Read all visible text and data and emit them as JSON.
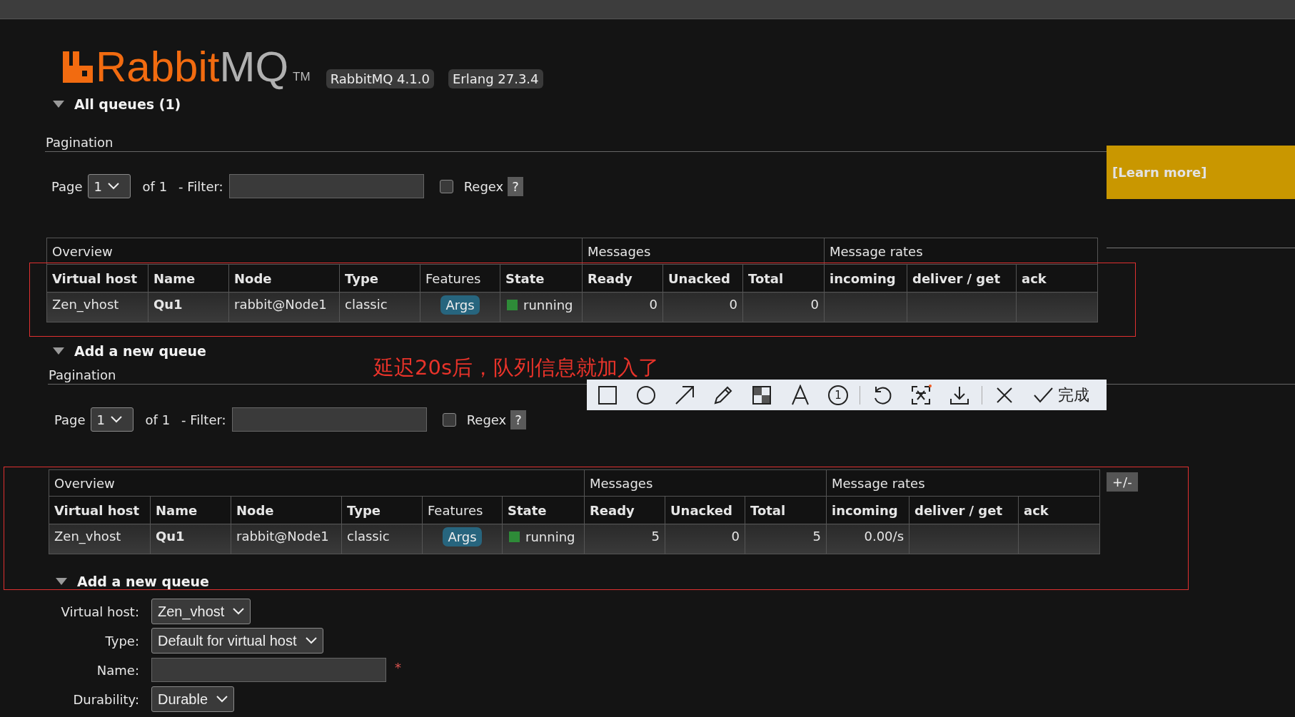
{
  "header": {
    "logo": [
      "Rabbit",
      "MQ"
    ],
    "trademark": "TM",
    "badges": [
      "RabbitMQ 4.1.0",
      "Erlang 27.3.4"
    ]
  },
  "learn_more": "[Learn more]",
  "blocks": [
    {
      "kind": "heading",
      "text": "All queues (1)",
      "expanded": true
    },
    {
      "kind": "pagination",
      "label": "Pagination",
      "page_label": "Page",
      "page": "1",
      "of": "of 1",
      "filter_label": "- Filter:",
      "regex": {
        "label": "Regex",
        "checked": false
      },
      "help": "?"
    },
    {
      "kind": "table",
      "groups": [
        {
          "label": "Overview",
          "columns": [
            {
              "label": "Virtual host"
            },
            {
              "label": "Name"
            },
            {
              "label": "Node"
            },
            {
              "label": "Type"
            },
            {
              "label": "Features",
              "kind": "plain"
            },
            {
              "label": "State"
            }
          ]
        },
        {
          "label": "Messages",
          "columns": [
            {
              "label": "Ready"
            },
            {
              "label": "Unacked"
            },
            {
              "label": "Total"
            }
          ]
        },
        {
          "label": "Message rates",
          "columns": [
            {
              "label": "incoming"
            },
            {
              "label": "deliver / get"
            },
            {
              "label": "ack"
            }
          ]
        }
      ],
      "rows": [
        {
          "cells": [
            {
              "kind": "text",
              "text": "Zen_vhost"
            },
            {
              "kind": "strong",
              "text": "Qu1"
            },
            {
              "kind": "text",
              "text": "rabbit@Node1"
            },
            {
              "kind": "text",
              "text": "classic"
            },
            {
              "kind": "badge",
              "text": "Args"
            },
            {
              "kind": "status",
              "text": "running",
              "color": "#2e8b38"
            },
            {
              "kind": "number",
              "text": "0"
            },
            {
              "kind": "number",
              "text": "0"
            },
            {
              "kind": "number",
              "text": "0"
            },
            {
              "kind": "empty"
            },
            {
              "kind": "empty"
            },
            {
              "kind": "empty"
            }
          ]
        }
      ]
    },
    {
      "kind": "heading",
      "text": "Add a new queue",
      "expanded": true
    },
    {
      "kind": "annotation",
      "text": "延迟20s后，队列信息就加入了"
    },
    {
      "kind": "pagination",
      "label": "Pagination",
      "page_label": "Page",
      "page": "1",
      "of": "of 1",
      "filter_label": "- Filter:",
      "regex": {
        "label": "Regex",
        "checked": false
      },
      "help": "?"
    },
    {
      "kind": "table",
      "toggle": "+/-",
      "groups": [
        {
          "label": "Overview",
          "columns": [
            {
              "label": "Virtual host"
            },
            {
              "label": "Name"
            },
            {
              "label": "Node"
            },
            {
              "label": "Type"
            },
            {
              "label": "Features",
              "kind": "plain"
            },
            {
              "label": "State"
            }
          ]
        },
        {
          "label": "Messages",
          "columns": [
            {
              "label": "Ready"
            },
            {
              "label": "Unacked"
            },
            {
              "label": "Total"
            }
          ]
        },
        {
          "label": "Message rates",
          "columns": [
            {
              "label": "incoming"
            },
            {
              "label": "deliver / get"
            },
            {
              "label": "ack"
            }
          ]
        }
      ],
      "rows": [
        {
          "cells": [
            {
              "kind": "text",
              "text": "Zen_vhost"
            },
            {
              "kind": "strong",
              "text": "Qu1"
            },
            {
              "kind": "text",
              "text": "rabbit@Node1"
            },
            {
              "kind": "text",
              "text": "classic"
            },
            {
              "kind": "badge",
              "text": "Args"
            },
            {
              "kind": "status",
              "text": "running",
              "color": "#2e8b38"
            },
            {
              "kind": "number",
              "text": "5"
            },
            {
              "kind": "number",
              "text": "0"
            },
            {
              "kind": "number",
              "text": "5"
            },
            {
              "kind": "number",
              "text": "0.00/s"
            },
            {
              "kind": "empty"
            },
            {
              "kind": "empty"
            }
          ]
        }
      ]
    },
    {
      "kind": "heading",
      "text": "Add a new queue",
      "expanded": true
    },
    {
      "kind": "form",
      "fields": [
        {
          "kind": "select",
          "label": "Virtual host:",
          "value": "Zen_vhost"
        },
        {
          "kind": "select",
          "label": "Type:",
          "value": "Default for virtual host"
        },
        {
          "kind": "input",
          "label": "Name:",
          "required_mark": "*"
        },
        {
          "kind": "select",
          "label": "Durability:",
          "value": "Durable"
        }
      ]
    }
  ],
  "capture_toolbar": {
    "tools": [
      {
        "kind": "rectangle"
      },
      {
        "kind": "ellipse"
      },
      {
        "kind": "arrow"
      },
      {
        "kind": "pencil"
      },
      {
        "kind": "mosaic"
      },
      {
        "kind": "text"
      },
      {
        "kind": "step",
        "label": "1"
      },
      {
        "kind": "divider"
      },
      {
        "kind": "undo"
      },
      {
        "kind": "ocr"
      },
      {
        "kind": "download"
      },
      {
        "kind": "divider"
      },
      {
        "kind": "close"
      },
      {
        "kind": "confirm",
        "label": "完成"
      }
    ]
  }
}
